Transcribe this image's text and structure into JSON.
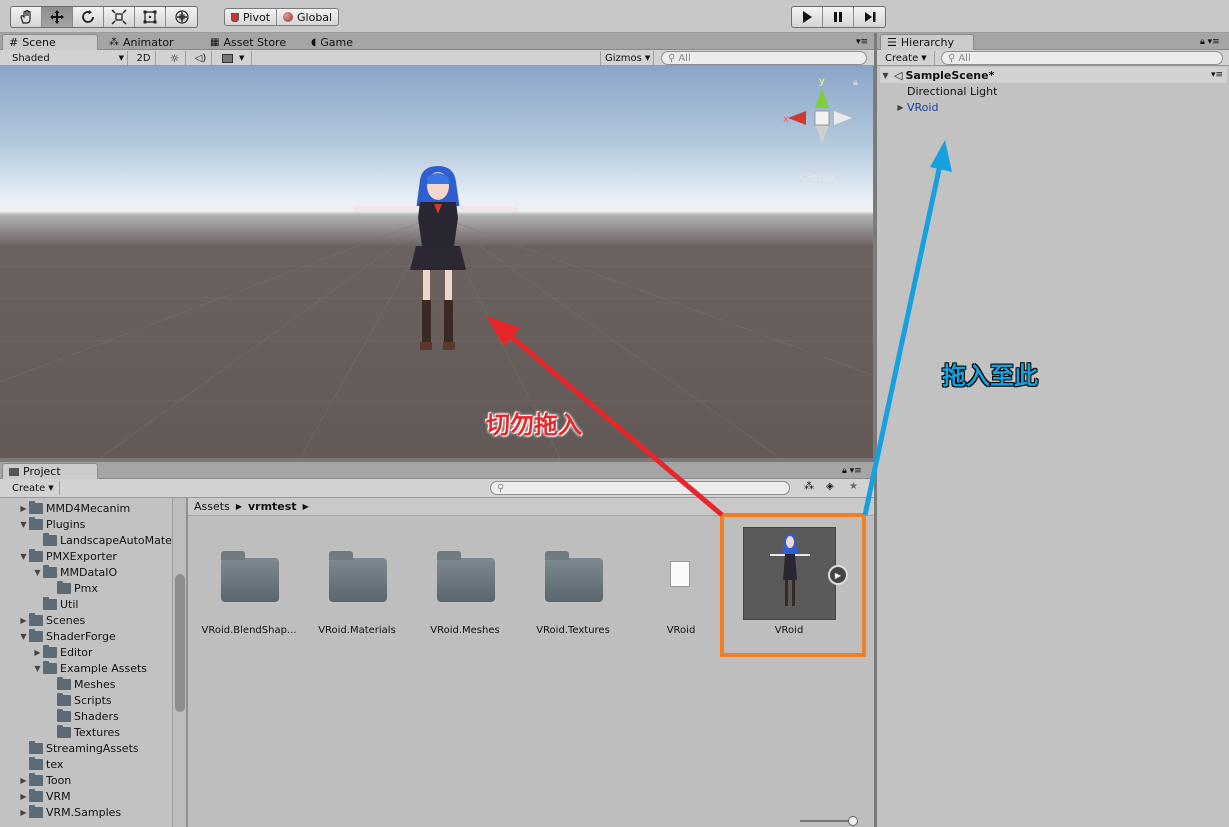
{
  "toolbar": {
    "tools": [
      "hand-icon",
      "move-icon",
      "rotate-icon",
      "scale-icon",
      "rect-icon",
      "transform-icon"
    ],
    "pivot_label": "Pivot",
    "global_label": "Global"
  },
  "scene_tabs": {
    "scene": "Scene",
    "animator": "Animator",
    "asset_store": "Asset Store",
    "game": "Game"
  },
  "scene_bar": {
    "shading": "Shaded",
    "mode_2d": "2D",
    "gizmos": "Gizmos",
    "search_placeholder": "All"
  },
  "gizmo": {
    "y": "y",
    "x": "x",
    "persp": "<Persp"
  },
  "hierarchy": {
    "tab": "Hierarchy",
    "create": "Create",
    "search_placeholder": "All",
    "scene_name": "SampleScene*",
    "items": [
      "Directional Light",
      "VRoid"
    ]
  },
  "project": {
    "tab": "Project",
    "create": "Create",
    "breadcrumb_root": "Assets",
    "breadcrumb_current": "vrmtest",
    "tree": [
      {
        "label": "MMD4Mecanim",
        "depth": 1,
        "fold": "closed"
      },
      {
        "label": "Plugins",
        "depth": 1,
        "fold": "open"
      },
      {
        "label": "LandscapeAutoMate",
        "depth": 2,
        "fold": "none"
      },
      {
        "label": "PMXExporter",
        "depth": 1,
        "fold": "open"
      },
      {
        "label": "MMDataIO",
        "depth": 2,
        "fold": "open"
      },
      {
        "label": "Pmx",
        "depth": 3,
        "fold": "none"
      },
      {
        "label": "Util",
        "depth": 2,
        "fold": "none"
      },
      {
        "label": "Scenes",
        "depth": 1,
        "fold": "closed"
      },
      {
        "label": "ShaderForge",
        "depth": 1,
        "fold": "open"
      },
      {
        "label": "Editor",
        "depth": 2,
        "fold": "closed"
      },
      {
        "label": "Example Assets",
        "depth": 2,
        "fold": "open"
      },
      {
        "label": "Meshes",
        "depth": 3,
        "fold": "none"
      },
      {
        "label": "Scripts",
        "depth": 3,
        "fold": "none"
      },
      {
        "label": "Shaders",
        "depth": 3,
        "fold": "none"
      },
      {
        "label": "Textures",
        "depth": 3,
        "fold": "none"
      },
      {
        "label": "StreamingAssets",
        "depth": 1,
        "fold": "none"
      },
      {
        "label": "tex",
        "depth": 1,
        "fold": "none"
      },
      {
        "label": "Toon",
        "depth": 1,
        "fold": "closed"
      },
      {
        "label": "VRM",
        "depth": 1,
        "fold": "closed"
      },
      {
        "label": "VRM.Samples",
        "depth": 1,
        "fold": "closed"
      }
    ],
    "assets": [
      {
        "label": "VRoid.BlendShap...",
        "kind": "folder"
      },
      {
        "label": "VRoid.Materials",
        "kind": "folder"
      },
      {
        "label": "VRoid.Meshes",
        "kind": "folder"
      },
      {
        "label": "VRoid.Textures",
        "kind": "folder"
      },
      {
        "label": "VRoid",
        "kind": "file"
      },
      {
        "label": "VRoid",
        "kind": "prefab"
      }
    ]
  },
  "annotations": {
    "do_not_drag": "切勿拖入",
    "drag_here": "拖入至此",
    "red": "#e8262a",
    "blue": "#17a0de",
    "orange": "#f47d20"
  }
}
